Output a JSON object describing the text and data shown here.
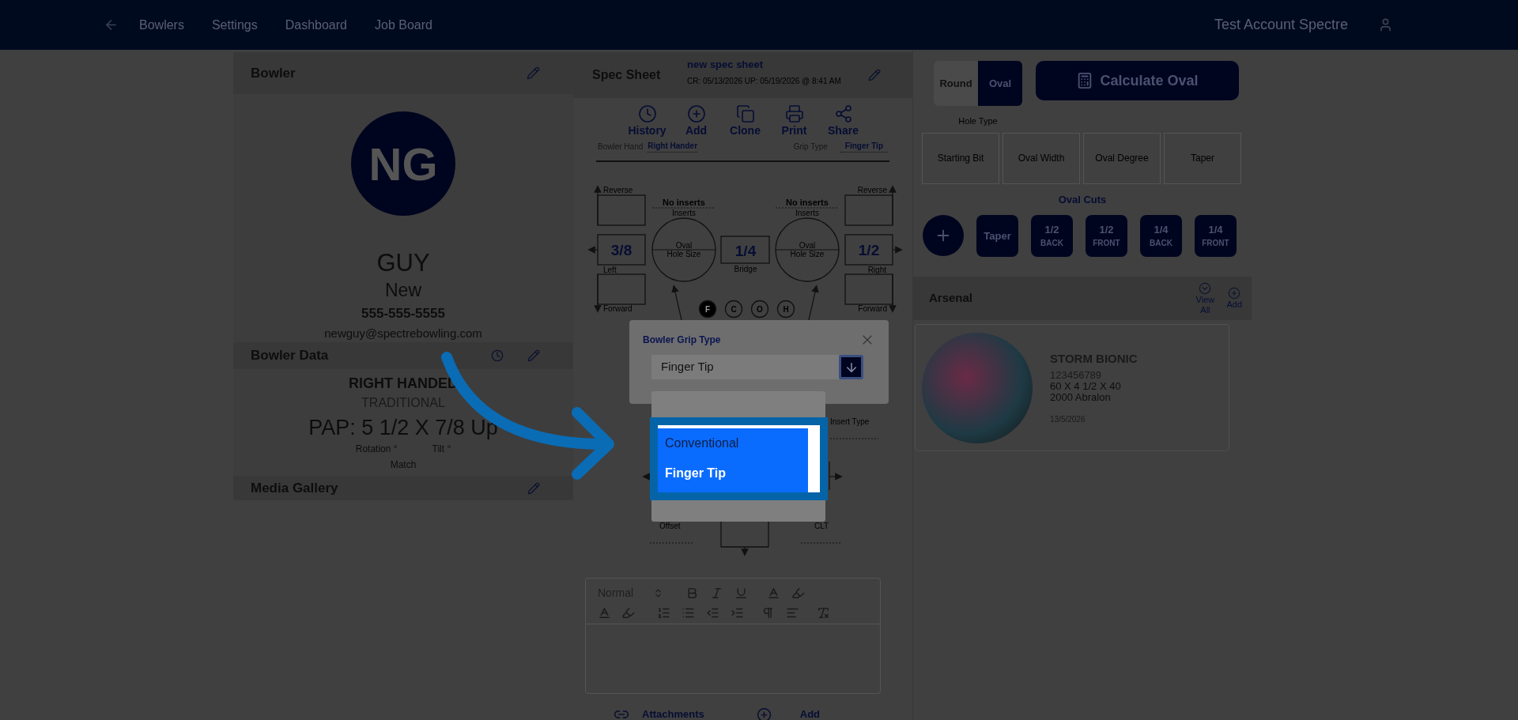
{
  "nav": {
    "links": [
      "Bowlers",
      "Settings",
      "Dashboard",
      "Job Board"
    ],
    "account": "Test Account Spectre"
  },
  "bowler": {
    "title": "Bowler",
    "initials": "NG",
    "last_name": "GUY",
    "first_name": "New",
    "phone": "555-555-5555",
    "email": "newguy@spectrebowling.com"
  },
  "bowler_data": {
    "title": "Bowler Data",
    "hand": "RIGHT HANDED",
    "grip": "TRADITIONAL",
    "pap": "PAP: 5 1/2 X 7/8 Up",
    "rotation": "Rotation °",
    "tilt": "Tilt °",
    "match": "Match"
  },
  "media_gallery": {
    "title": "Media Gallery"
  },
  "spec_sheet": {
    "title": "Spec Sheet",
    "name": "new spec sheet",
    "dates": "CR: 05/13/2026 UP: 05/19/2026 @ 8:41 AM",
    "actions": [
      {
        "kind": "history",
        "label": "History"
      },
      {
        "kind": "add",
        "label": "Add"
      },
      {
        "kind": "clone",
        "label": "Clone"
      },
      {
        "kind": "print",
        "label": "Print"
      },
      {
        "kind": "share",
        "label": "Share"
      }
    ],
    "bowler_hand_label": "Bowler Hand",
    "bowler_hand": "Right Hander",
    "grip_type_label": "Grip Type",
    "grip_type": "Finger Tip"
  },
  "diagram": {
    "reverse_left": "Reverse",
    "reverse_right": "Reverse",
    "forward_left": "Forward",
    "forward_right": "Forward",
    "left_value": "3/8",
    "left_label": "Left",
    "bridge_value": "1/4",
    "bridge_label": "Bridge",
    "right_value": "1/2",
    "right_label": "Right",
    "holes": [
      {
        "inserts_value": "No inserts",
        "inserts_label": "Inserts",
        "hole_type": "Oval",
        "hole_size_label": "Hole Size"
      },
      {
        "inserts_value": "No inserts",
        "inserts_label": "Inserts",
        "hole_type": "Oval",
        "hole_size_label": "Hole Size"
      }
    ],
    "fingers": [
      {
        "label": "F",
        "selected": true
      },
      {
        "label": "C",
        "selected": false
      },
      {
        "label": "O",
        "selected": false
      },
      {
        "label": "H",
        "selected": false
      }
    ],
    "insert_type_label": "Insert Type",
    "offset_label": "Offset",
    "clt_label": "CLT"
  },
  "modal": {
    "title": "Bowler Grip Type",
    "value": "Finger Tip",
    "options": [
      {
        "label": "Conventional",
        "selected": false
      },
      {
        "label": "Finger Tip",
        "selected": true
      }
    ]
  },
  "editor": {
    "format": "Normal"
  },
  "attachments": {
    "label": "Attachments",
    "add": "Add"
  },
  "hole_type": {
    "label": "Hole Type",
    "options": [
      {
        "label": "Round",
        "selected": false
      },
      {
        "label": "Oval",
        "selected": true
      }
    ]
  },
  "calculate_button": "Calculate Oval",
  "measurements": [
    "Starting Bit",
    "Oval Width",
    "Oval Degree",
    "Taper"
  ],
  "oval_cuts": {
    "title": "Oval Cuts",
    "buttons": [
      {
        "kind": "text",
        "label": "Taper"
      },
      {
        "kind": "fraction",
        "value": "1/2",
        "label": "BACK"
      },
      {
        "kind": "fraction",
        "value": "1/2",
        "label": "FRONT"
      },
      {
        "kind": "fraction",
        "value": "1/4",
        "label": "BACK"
      },
      {
        "kind": "fraction",
        "value": "1/4",
        "label": "FRONT"
      }
    ]
  },
  "arsenal": {
    "title": "Arsenal",
    "view_all": "View All",
    "add": "Add",
    "balls": [
      {
        "name": "STORM BIONIC",
        "serial": "123456789",
        "layout": "60 X 4 1/2 X 40",
        "surface": "2000 Abralon",
        "date": "13/5/2026"
      }
    ]
  }
}
